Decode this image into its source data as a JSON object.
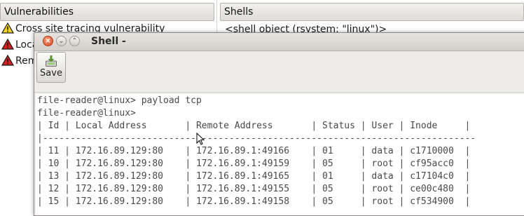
{
  "vulnerabilities": {
    "header": "Vulnerabilities",
    "items": [
      {
        "label": "Cross site tracing vulnerability",
        "severity": "warning",
        "icon": "warning-yellow-icon"
      },
      {
        "label": "Loca",
        "severity": "high",
        "icon": "warning-red-icon"
      },
      {
        "label": "Rem",
        "severity": "high",
        "icon": "warning-red-icon"
      }
    ]
  },
  "shells": {
    "header": "Shells",
    "items": [
      "<shell object (rsystem: \"linux\")>"
    ]
  },
  "shell_window": {
    "title": "Shell -",
    "close_glyph": "×",
    "minimize_glyph": "⌄",
    "maximize_glyph": "⌃",
    "toolbar": {
      "save_label": "Save"
    },
    "terminal": {
      "lines": [
        "file-reader@linux> payload tcp",
        "file-reader@linux>",
        "| Id | Local Address       | Remote Address       | Status | User | Inode     |",
        "|-------------------------------------------------------------------------------",
        "| 11 | 172.16.89.129:80    | 172.16.89.1:49166    | 01     | data | c1710000  |",
        "| 10 | 172.16.89.129:80    | 172.16.89.1:49159    | 05     | root | cf95acc0  |",
        "| 13 | 172.16.89.129:80    | 172.16.89.1:49165    | 01     | data | c17104c0  |",
        "| 12 | 172.16.89.129:80    | 172.16.89.1:49155    | 05     | root | ce00c480  |",
        "| 15 | 172.16.89.129:80    | 172.16.89.1:49158    | 05     | root | cf534900  |"
      ]
    }
  },
  "colors": {
    "warning_yellow": "#f5d319",
    "warning_red": "#d21f1f",
    "close_button": "#d9461c"
  }
}
